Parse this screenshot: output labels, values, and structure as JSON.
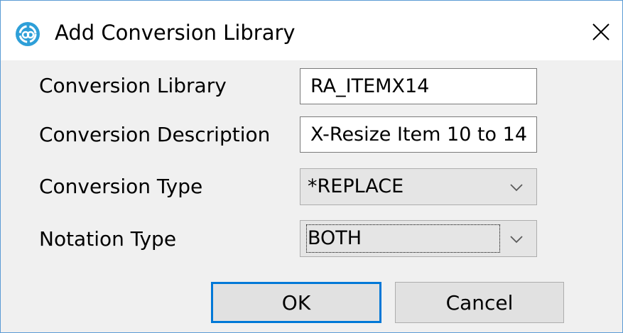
{
  "window": {
    "title": "Add Conversion Library",
    "app_icon": "circular-arrows-app-icon",
    "close_icon": "close-icon",
    "accent_color": "#0078d7"
  },
  "form": {
    "library": {
      "label": "Conversion Library",
      "value": "RA_ITEMX14"
    },
    "description": {
      "label": "Conversion Description",
      "value": "X-Resize Item 10 to 14"
    },
    "conversion_type": {
      "label": "Conversion Type",
      "value": "*REPLACE",
      "icon": "chevron-down-icon"
    },
    "notation_type": {
      "label": "Notation Type",
      "value": "BOTH",
      "icon": "chevron-down-icon"
    }
  },
  "buttons": {
    "ok_label": "OK",
    "cancel_label": "Cancel"
  }
}
